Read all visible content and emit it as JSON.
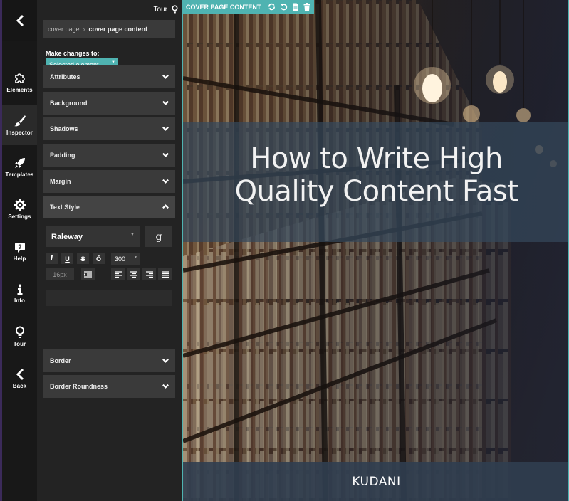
{
  "rail": {
    "items": [
      {
        "label": "Elements",
        "icon": "puzzle-icon"
      },
      {
        "label": "Inspector",
        "icon": "brush-icon"
      },
      {
        "label": "Templates",
        "icon": "rocket-icon"
      },
      {
        "label": "Settings",
        "icon": "gear-icon"
      },
      {
        "label": "Help",
        "icon": "question-icon"
      },
      {
        "label": "Info",
        "icon": "info-icon"
      },
      {
        "label": "Tour",
        "icon": "lightbulb-icon"
      },
      {
        "label": "Back",
        "icon": "chevron-left-icon"
      }
    ],
    "active": "Inspector"
  },
  "panel": {
    "tour_label": "Tour",
    "breadcrumb": {
      "parent": "cover page",
      "current": "cover page content"
    },
    "make_changes_label": "Make changes to:",
    "target_select": "Selected element",
    "sections": {
      "attributes": "Attributes",
      "background": "Background",
      "shadows": "Shadows",
      "padding": "Padding",
      "margin": "Margin",
      "text_style": "Text Style",
      "border": "Border",
      "border_roundness": "Border Roundness"
    },
    "text_style": {
      "font": "Raleway",
      "google_fonts_glyph": "g",
      "italic": "I",
      "underline": "U",
      "strike": "S",
      "overline": "Ō",
      "weight": "300",
      "size_placeholder": "16px"
    }
  },
  "canvas": {
    "toolbar_label": "COVER PAGE CONTENT",
    "title": "How to Write High Quality Content Fast",
    "brand": "KUDANI"
  },
  "colors": {
    "accent": "#4fb3b1",
    "panel_bg": "#232323",
    "section_bg": "#3a3a3a",
    "rail_bg": "#181818"
  }
}
